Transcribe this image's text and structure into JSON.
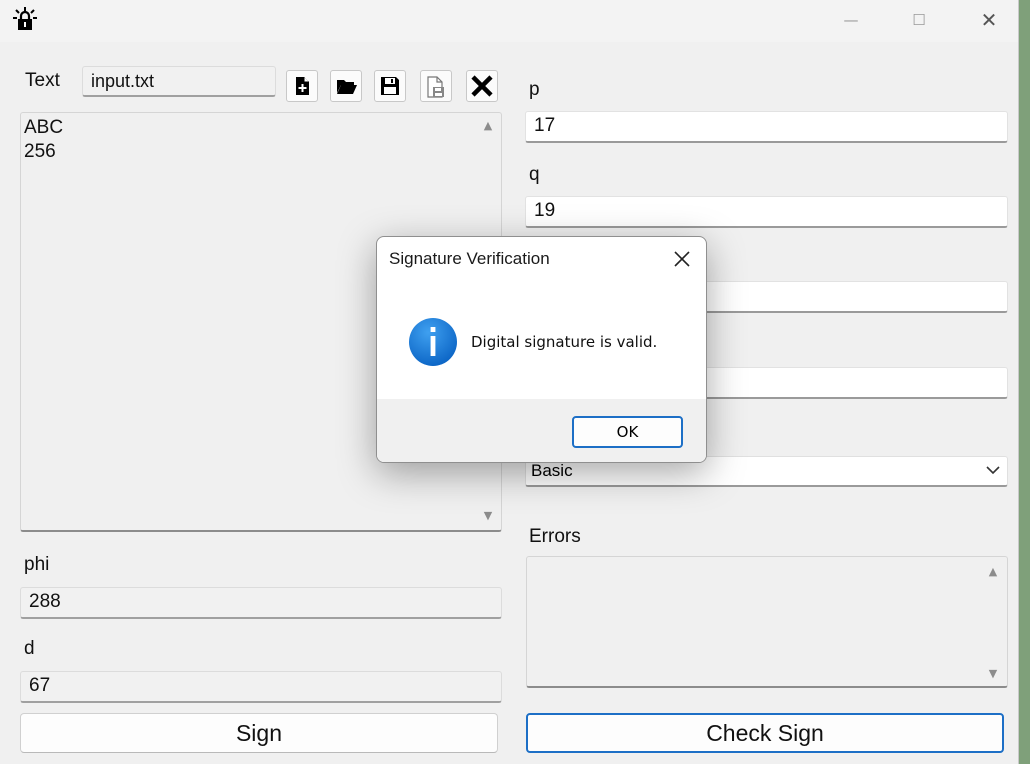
{
  "window": {
    "controls": {
      "minimize": "—",
      "maximize": "☐",
      "close": "✕"
    }
  },
  "text_section": {
    "label": "Text",
    "filename": "input.txt",
    "toolbar_icons": [
      "new-file-icon",
      "open-folder-icon",
      "save-icon",
      "save-as-icon",
      "clear-icon"
    ],
    "content_lines": [
      "ABC",
      "256"
    ]
  },
  "fields": {
    "phi": {
      "label": "phi",
      "value": "288"
    },
    "d": {
      "label": "d",
      "value": "67"
    },
    "p": {
      "label": "p",
      "value": "17"
    },
    "q": {
      "label": "q",
      "value": "19"
    }
  },
  "mode_select": {
    "value": "Basic"
  },
  "errors": {
    "label": "Errors"
  },
  "buttons": {
    "sign": "Sign",
    "check_sign": "Check Sign"
  },
  "dialog": {
    "title": "Signature Verification",
    "message": "Digital signature is valid.",
    "ok": "OK",
    "icon_glyph": "i"
  },
  "colors": {
    "accent": "#1d6fc6",
    "info_icon": "#1478d4"
  }
}
